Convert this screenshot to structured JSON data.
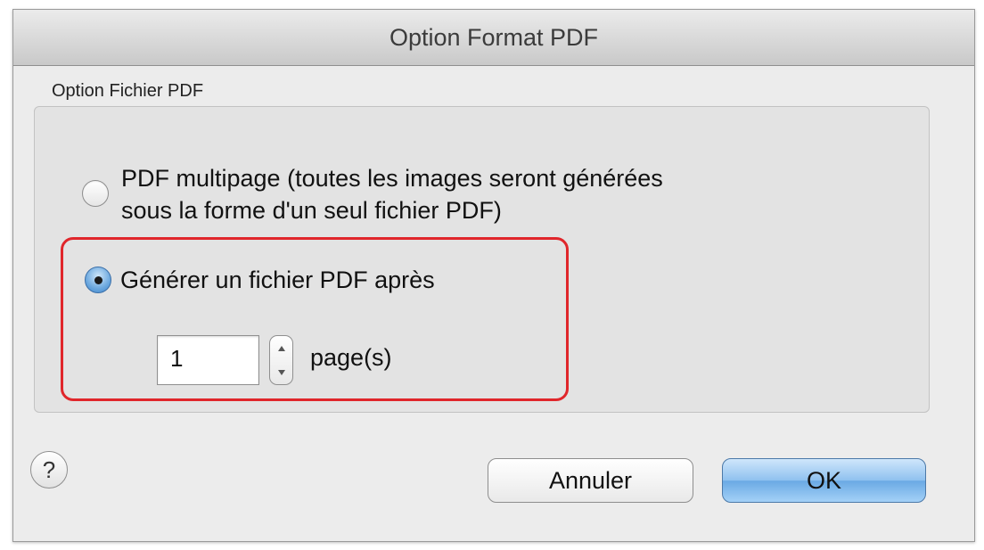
{
  "window": {
    "title": "Option Format PDF"
  },
  "group": {
    "label": "Option Fichier PDF"
  },
  "options": [
    {
      "label_line1": "PDF multipage (toutes les images seront générées",
      "label_line2": "sous la forme d'un seul fichier PDF)",
      "selected": false
    },
    {
      "label_line1": "Générer un fichier PDF après",
      "selected": true
    }
  ],
  "pages": {
    "value": "1",
    "unit": "page(s)"
  },
  "footer": {
    "help_label": "?",
    "cancel_label": "Annuler",
    "ok_label": "OK"
  },
  "colors": {
    "highlight_border": "#e0262b",
    "default_button": "#6aa9e4"
  }
}
